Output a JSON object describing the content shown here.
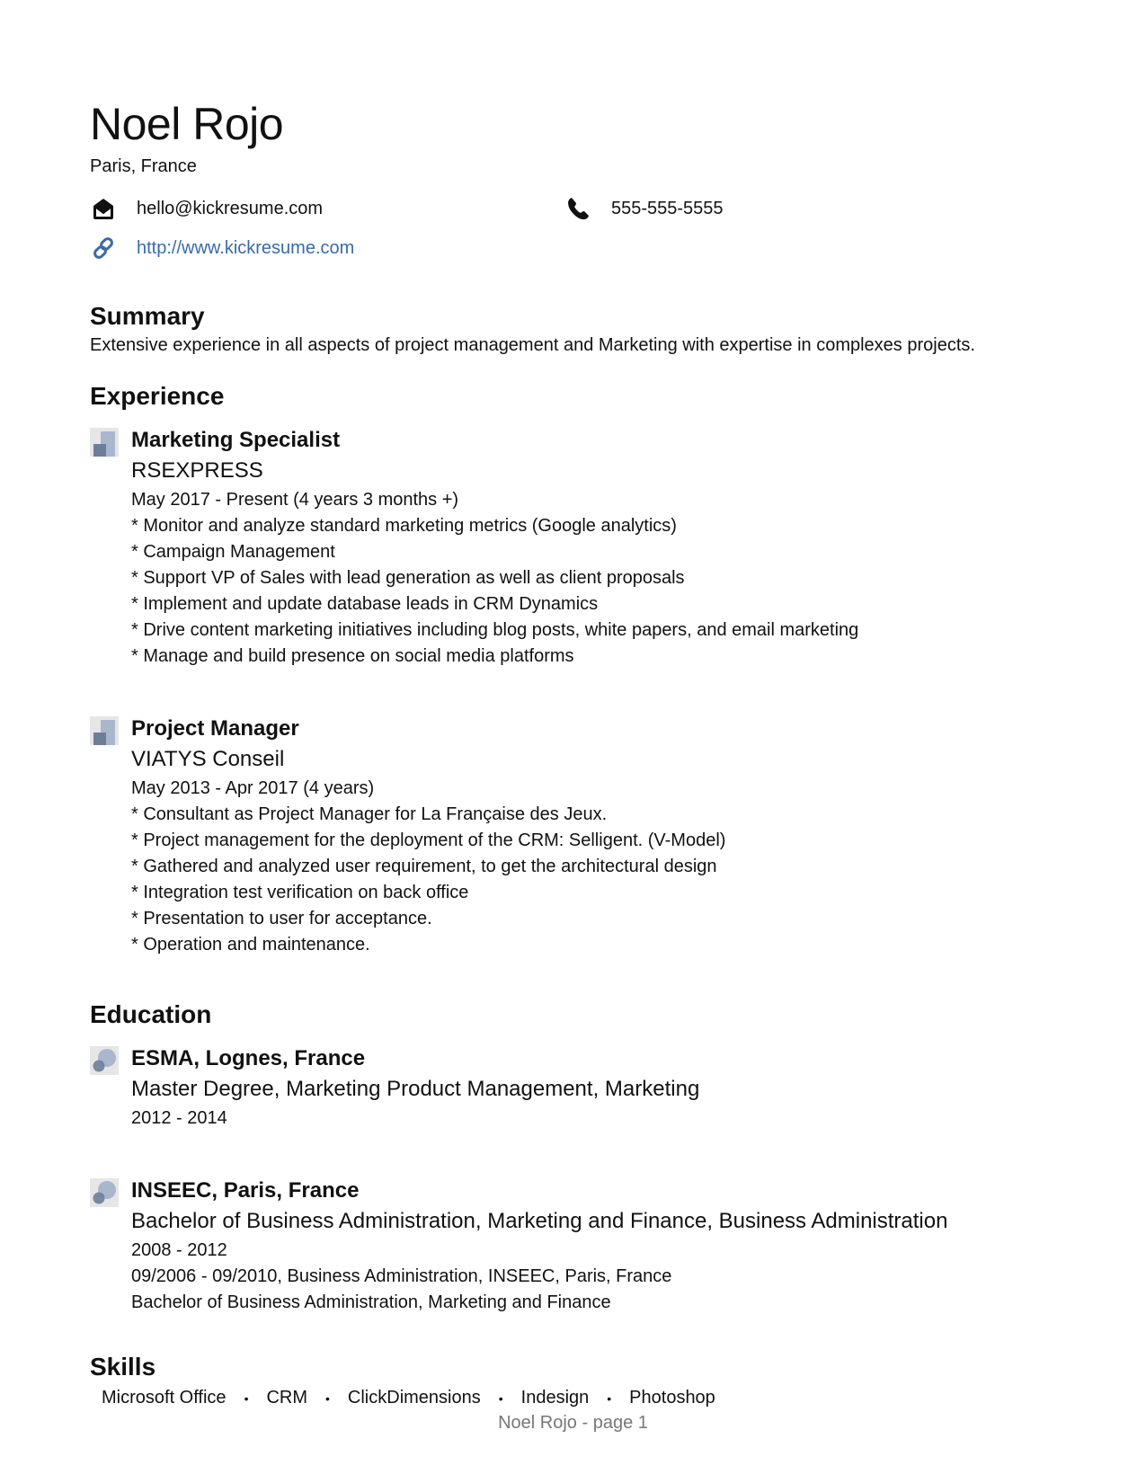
{
  "header": {
    "name": "Noel Rojo",
    "location": "Paris, France",
    "email": "hello@kickresume.com",
    "phone": "555-555-5555",
    "website": "http://www.kickresume.com",
    "link_color": "#3b6aa8"
  },
  "summary": {
    "heading": "Summary",
    "text": "Extensive experience in all aspects of project management and Marketing with expertise in complexes projects."
  },
  "experience": {
    "heading": "Experience",
    "items": [
      {
        "title": "Marketing Specialist",
        "company": "RSEXPRESS",
        "dates": "May 2017 - Present (4 years 3 months +)",
        "bullets": [
          "* Monitor and analyze standard marketing metrics (Google analytics)",
          "* Campaign Management",
          "* Support VP of Sales with lead generation as well as client proposals",
          "* Implement and update database leads in CRM Dynamics",
          "* Drive content marketing initiatives including blog posts, white papers, and email marketing",
          "* Manage and build presence on social media platforms"
        ]
      },
      {
        "title": "Project Manager",
        "company": "VIATYS Conseil",
        "dates": "May 2013 - Apr 2017 (4 years)",
        "bullets": [
          "* Consultant as Project Manager for La Française des Jeux.",
          "* Project management for the deployment of the CRM: Selligent. (V-Model)",
          "* Gathered and analyzed user requirement, to get the architectural design",
          "* Integration test verification on back office",
          "* Presentation to user for acceptance.",
          "* Operation and maintenance."
        ]
      }
    ]
  },
  "education": {
    "heading": "Education",
    "items": [
      {
        "school": "ESMA, Lognes, France",
        "degree": "Master Degree, Marketing Product Management, Marketing",
        "dates": "2012 - 2014",
        "extra": []
      },
      {
        "school": "INSEEC, Paris, France",
        "degree": "Bachelor of Business Administration, Marketing and Finance, Business Administration",
        "dates": "2008 - 2012",
        "extra": [
          "09/2006 - 09/2010, Business Administration, INSEEC, Paris, France",
          "Bachelor of Business Administration, Marketing and Finance"
        ]
      }
    ]
  },
  "skills": {
    "heading": "Skills",
    "items": [
      "Microsoft Office",
      "CRM",
      "ClickDimensions",
      "Indesign",
      "Photoshop"
    ],
    "separator": "•"
  },
  "footer": {
    "text": "Noel Rojo - page 1"
  }
}
